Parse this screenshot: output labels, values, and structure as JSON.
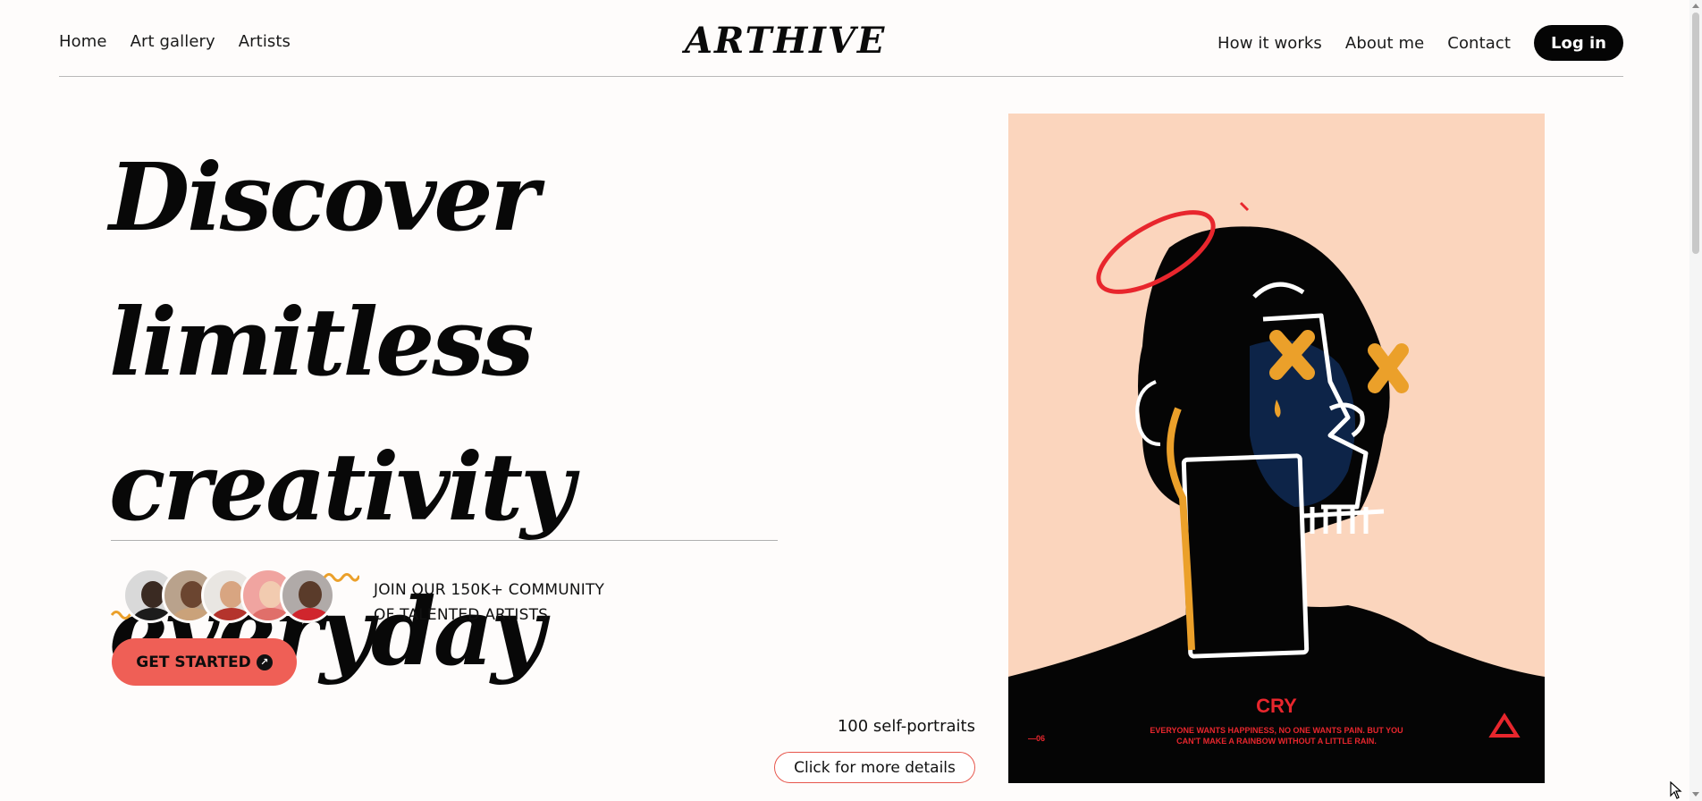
{
  "nav": {
    "left_links": [
      "Home",
      "Art gallery",
      "Artists"
    ],
    "logo": "ARTHIVE",
    "right_links": [
      "How it works",
      "About me",
      "Contact"
    ],
    "login_label": "Log in"
  },
  "hero": {
    "headline_lines": [
      "Discover limitless",
      "creativity",
      "everyday"
    ],
    "community_line1": "JOIN OUR 150K+ COMMUNITY",
    "community_line2": "OF TALENTED ARTISTS",
    "cta_label": "GET STARTED",
    "portrait_count_label": "100 self-portraits",
    "details_label": "Click for more details"
  },
  "artwork": {
    "title": "CRY",
    "caption_line1": "EVERYONE WANTS HAPPINESS, NO ONE WANTS PAIN. BUT YOU",
    "caption_line2": "CAN'T MAKE A RAINBOW WITHOUT A LITTLE RAIN.",
    "number": "—06"
  },
  "colors": {
    "accent": "#ef5f56",
    "artwork_bg": "#fbd5bd",
    "artwork_red": "#e8262d",
    "artwork_orange": "#eba02a"
  },
  "icons": [
    "arrow-up-right-icon",
    "recycle-icon",
    "squiggle-icon"
  ]
}
